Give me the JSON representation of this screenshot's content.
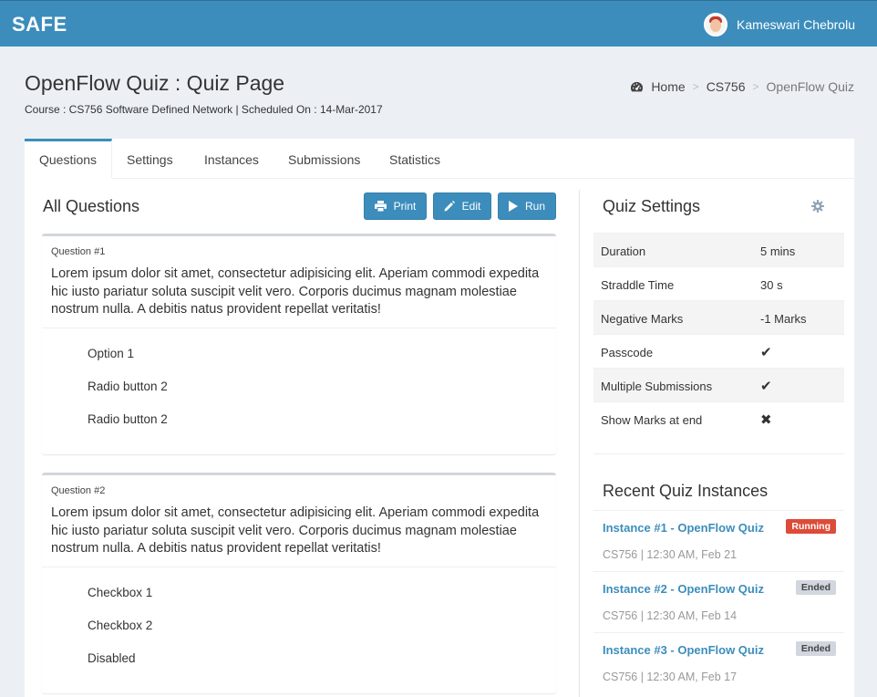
{
  "topbar": {
    "brand": "SAFE",
    "user_name": "Kameswari Chebrolu"
  },
  "header": {
    "title": "OpenFlow Quiz : Quiz Page",
    "subtitle": "Course : CS756 Software Defined Network | Scheduled On : 14-Mar-2017"
  },
  "breadcrumb": {
    "home": "Home",
    "course": "CS756",
    "current": "OpenFlow Quiz",
    "separator": ">"
  },
  "tabs": [
    {
      "label": "Questions",
      "active": true
    },
    {
      "label": "Settings",
      "active": false
    },
    {
      "label": "Instances",
      "active": false
    },
    {
      "label": "Submissions",
      "active": false
    },
    {
      "label": "Statistics",
      "active": false
    }
  ],
  "questions_panel": {
    "title": "All Questions",
    "buttons": {
      "print": "Print",
      "edit": "Edit",
      "run": "Run"
    },
    "questions": [
      {
        "number": "Question #1",
        "text": "Lorem ipsum dolor sit amet, consectetur adipisicing elit. Aperiam commodi expedita hic iusto pariatur soluta suscipit velit vero. Corporis ducimus magnam molestiae nostrum nulla. A debitis natus provident repellat veritatis!",
        "options": [
          "Option 1",
          "Radio button 2",
          "Radio button 2"
        ]
      },
      {
        "number": "Question #2",
        "text": "Lorem ipsum dolor sit amet, consectetur adipisicing elit. Aperiam commodi expedita hic iusto pariatur soluta suscipit velit vero. Corporis ducimus magnam molestiae nostrum nulla. A debitis natus provident repellat veritatis!",
        "options": [
          "Checkbox 1",
          "Checkbox 2",
          "Disabled"
        ]
      }
    ]
  },
  "quiz_settings": {
    "title": "Quiz Settings",
    "rows": [
      {
        "key": "Duration",
        "value": "5 mins"
      },
      {
        "key": "Straddle Time",
        "value": "30 s"
      },
      {
        "key": "Negative Marks",
        "value": "-1 Marks"
      },
      {
        "key": "Passcode",
        "value": "✔"
      },
      {
        "key": "Multiple Submissions",
        "value": "✔"
      },
      {
        "key": "Show Marks at end",
        "value": "✖"
      }
    ]
  },
  "recent_instances": {
    "title": "Recent Quiz Instances",
    "items": [
      {
        "name": "Instance #1 - OpenFlow Quiz",
        "meta": "CS756 | 12:30 AM, Feb 21",
        "status": "Running"
      },
      {
        "name": "Instance #2 - OpenFlow Quiz",
        "meta": "CS756 | 12:30 AM, Feb 14",
        "status": "Ended"
      },
      {
        "name": "Instance #3 - OpenFlow Quiz",
        "meta": "CS756 | 12:30 AM, Feb 17",
        "status": "Ended"
      }
    ]
  },
  "colors": {
    "primary": "#3c8dbc",
    "danger": "#dd4b39",
    "muted_badge": "#d2d6de",
    "background": "#ecf0f5"
  }
}
